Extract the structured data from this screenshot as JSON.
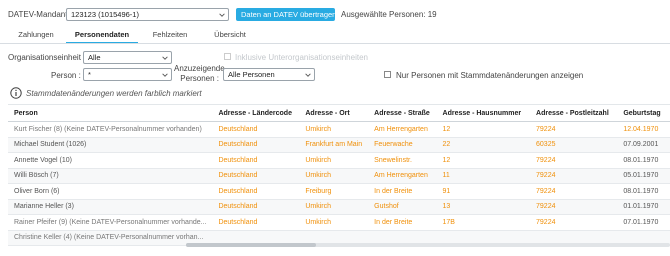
{
  "header": {
    "mandant_label": "DATEV-Mandant :",
    "mandant_value": "123123 (1015496-1)",
    "transfer_button": "Daten an DATEV übertragen",
    "selected_persons": "Ausgewählte Personen: 19"
  },
  "tabs": [
    {
      "label": "Zahlungen"
    },
    {
      "label": "Personendaten"
    },
    {
      "label": "Fehlzeiten"
    },
    {
      "label": "Übersicht"
    }
  ],
  "filters": {
    "org_unit_label": "Organisationseinheit :",
    "org_unit_value": "Alle",
    "include_sub_label": "Inklusive Unterorganisationseinheiten",
    "person_label": "Person :",
    "person_value": "*",
    "shown_persons_label_1": "Anzuzeigende",
    "shown_persons_label_2": "Personen :",
    "shown_persons_value": "Alle Personen",
    "only_changes_label": "Nur Personen mit Stammdatenänderungen anzeigen"
  },
  "info": {
    "icon": "info-icon",
    "text": "Stammdatenänderungen werden farblich markiert"
  },
  "table": {
    "columns": [
      "Person",
      "Adresse - Ländercode",
      "Adresse - Ort",
      "Adresse - Straße",
      "Adresse - Hausnummer",
      "Adresse - Postleitzahl",
      "Geburtstag"
    ],
    "rows": [
      {
        "cells": [
          "Kurt Fischer (8) (Keine DATEV-Personalnummer vorhanden)",
          "Deutschland",
          "Umkirch",
          "Am Herrengarten",
          "12",
          "79224",
          "12.04.1970"
        ],
        "changed": [
          1,
          2,
          3,
          4,
          5,
          6
        ],
        "muted": true
      },
      {
        "cells": [
          "Michael Student (1026)",
          "Deutschland",
          "Frankfurt am Main",
          "Feuerwache",
          "22",
          "60325",
          "07.09.2001"
        ],
        "changed": [
          1,
          2,
          3,
          4,
          5
        ],
        "muted": false
      },
      {
        "cells": [
          "Annette Vogel (10)",
          "Deutschland",
          "Umkirch",
          "Snewelinstr.",
          "12",
          "79224",
          "08.01.1970"
        ],
        "changed": [
          1,
          2,
          3,
          4,
          5
        ],
        "muted": false
      },
      {
        "cells": [
          "Willi Bösch (7)",
          "Deutschland",
          "Umkirch",
          "Am Herrengarten",
          "11",
          "79224",
          "05.01.1970"
        ],
        "changed": [
          1,
          2,
          3,
          4,
          5
        ],
        "muted": false
      },
      {
        "cells": [
          "Oliver Born (6)",
          "Deutschland",
          "Freiburg",
          "In der Breite",
          "91",
          "79224",
          "08.01.1970"
        ],
        "changed": [
          1,
          2,
          3,
          4,
          5
        ],
        "muted": false
      },
      {
        "cells": [
          "Marianne Heller (3)",
          "Deutschland",
          "Umkirch",
          "Gutshof",
          "13",
          "79224",
          "01.01.1970"
        ],
        "changed": [
          1,
          2,
          3,
          4,
          5
        ],
        "muted": false
      },
      {
        "cells": [
          "Rainer Pfeifer (9) (Keine DATEV-Personalnummer vorhande...",
          "Deutschland",
          "Umkirch",
          "In der Breite",
          "17B",
          "79224",
          "07.01.1970"
        ],
        "changed": [
          1,
          2,
          3,
          4,
          5
        ],
        "muted": true
      },
      {
        "cells": [
          "Christine Keller (4) (Keine DATEV-Personalnummer vorhan...",
          "",
          "",
          "",
          "",
          "",
          ""
        ],
        "changed": [],
        "muted": true
      }
    ]
  },
  "colors": {
    "accent": "#29abe2",
    "changed": "#f0900a"
  }
}
